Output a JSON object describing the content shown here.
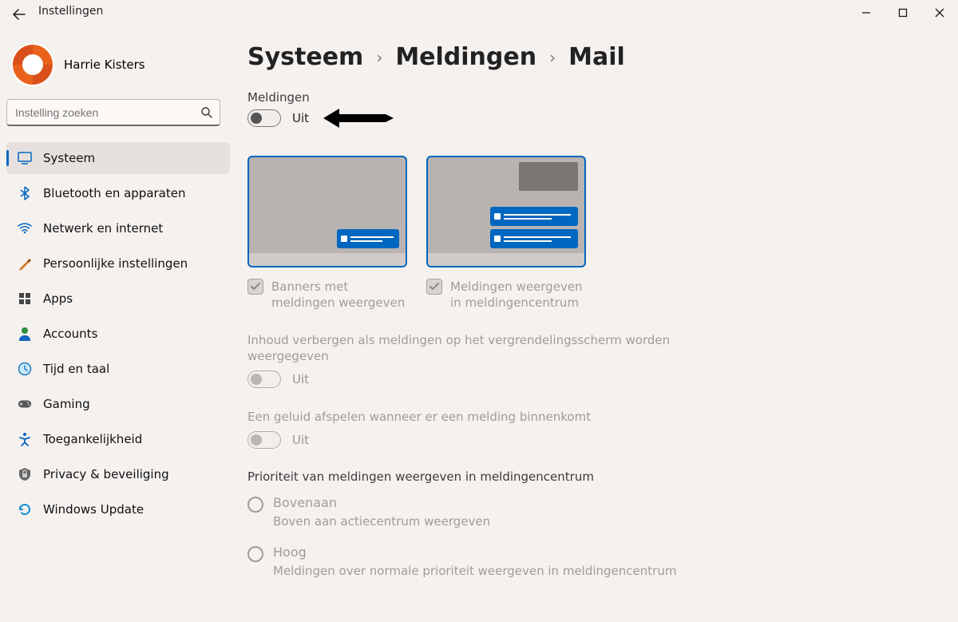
{
  "window": {
    "title": "Instellingen"
  },
  "user": {
    "name": "Harrie Kisters"
  },
  "search": {
    "placeholder": "Instelling zoeken"
  },
  "sidebar": [
    {
      "id": "systeem",
      "label": "Systeem",
      "active": true
    },
    {
      "id": "bluetooth",
      "label": "Bluetooth en apparaten",
      "active": false
    },
    {
      "id": "network",
      "label": "Netwerk en internet",
      "active": false
    },
    {
      "id": "personalize",
      "label": "Persoonlijke instellingen",
      "active": false
    },
    {
      "id": "apps",
      "label": "Apps",
      "active": false
    },
    {
      "id": "accounts",
      "label": "Accounts",
      "active": false
    },
    {
      "id": "time",
      "label": "Tijd en taal",
      "active": false
    },
    {
      "id": "gaming",
      "label": "Gaming",
      "active": false
    },
    {
      "id": "access",
      "label": "Toegankelijkheid",
      "active": false
    },
    {
      "id": "privacy",
      "label": "Privacy & beveiliging",
      "active": false
    },
    {
      "id": "update",
      "label": "Windows Update",
      "active": false
    }
  ],
  "crumbs": {
    "c1": "Systeem",
    "c2": "Meldingen",
    "current": "Mail"
  },
  "main": {
    "notif_label": "Meldingen",
    "notif_state": "Uit",
    "preview": {
      "banners_label": "Banners met meldingen weergeven",
      "action_center_label": "Meldingen weergeven in meldingencentrum"
    },
    "hide_lock": {
      "desc": "Inhoud verbergen als meldingen op het vergrendelingsscherm worden weergegeven",
      "state": "Uit"
    },
    "sound": {
      "desc": "Een geluid afspelen wanneer er een melding binnenkomt",
      "state": "Uit"
    },
    "priority": {
      "title": "Prioriteit van meldingen weergeven in meldingencentrum",
      "opts": [
        {
          "label": "Bovenaan",
          "desc": "Boven aan actiecentrum weergeven"
        },
        {
          "label": "Hoog",
          "desc": "Meldingen over normale prioriteit weergeven in meldingencentrum"
        }
      ]
    }
  }
}
